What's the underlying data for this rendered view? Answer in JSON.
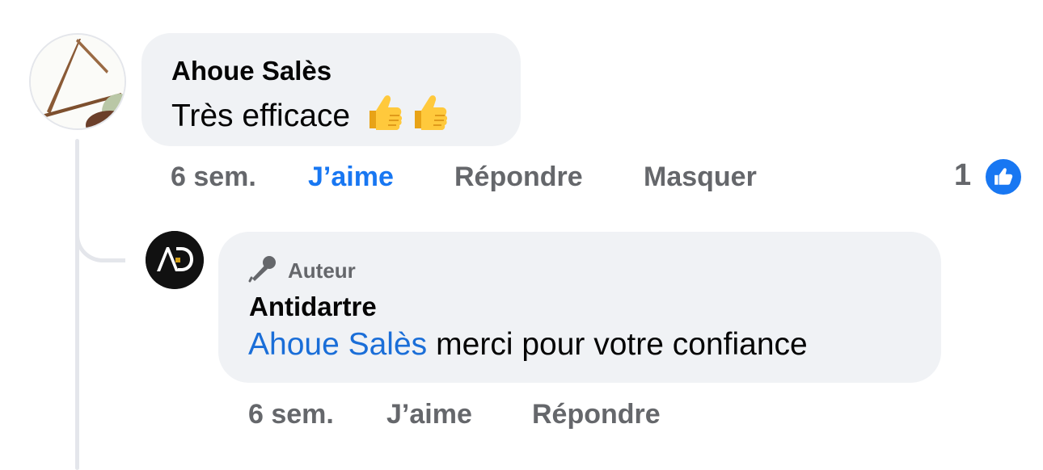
{
  "comment": {
    "author": "Ahoue Salès",
    "text": "Très efficace",
    "emoji_icons": [
      "thumbs-up-emoji",
      "thumbs-up-emoji"
    ],
    "time": "6 sem.",
    "actions": {
      "like": "J’aime",
      "reply": "Répondre",
      "hide": "Masquer"
    },
    "like_state": "liked",
    "reaction_count": "1",
    "reaction_icon": "like-thumb-icon",
    "colors": {
      "liked": "#1877f2",
      "reaction_badge": "#1877f2"
    }
  },
  "reply": {
    "badge": "Auteur",
    "badge_icon": "microphone-icon",
    "author": "Antidartre",
    "mention": "Ahoue Salès",
    "text": "merci pour votre confiance",
    "time": "6 sem.",
    "actions": {
      "like": "J’aime",
      "reply": "Répondre"
    },
    "avatar_logo": "AD",
    "colors": {
      "mention": "#1a6ed8",
      "avatar_bg": "#111111"
    }
  }
}
